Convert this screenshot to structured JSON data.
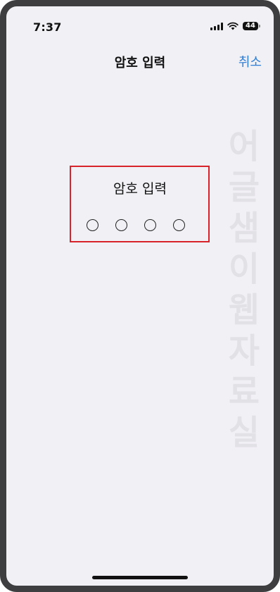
{
  "status_bar": {
    "time": "7:37",
    "battery_level": "44",
    "icons": [
      "signal-icon",
      "wifi-icon",
      "battery-icon"
    ]
  },
  "nav": {
    "title": "암호 입력",
    "cancel_label": "취소"
  },
  "passcode": {
    "prompt": "암호 입력",
    "dot_count": 4,
    "filled_count": 0
  },
  "watermark": "어글샘이웹자료실",
  "colors": {
    "accent": "#2f7fd6",
    "highlight_border": "#d8232a",
    "background": "#f1f0f5",
    "frame": "#3e3e40"
  }
}
